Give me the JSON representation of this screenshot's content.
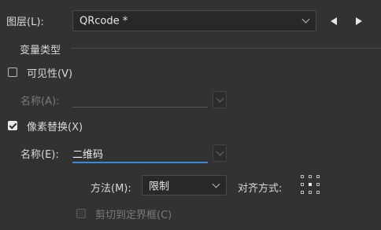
{
  "layer": {
    "label": "图层(L):",
    "value": "QRcode *"
  },
  "variable_types": {
    "title": "变量类型"
  },
  "visibility": {
    "label": "可见性(V)",
    "checked": false,
    "name_label": "名称(A):",
    "name_value": ""
  },
  "pixel_replace": {
    "label": "像素替换(X)",
    "checked": true,
    "name_label": "名称(E):",
    "name_value": "二维码",
    "method_label": "方法(M):",
    "method_value": "限制",
    "align_label": "对齐方式:",
    "clip_label": "剪切到定界框(C)",
    "clip_checked": false
  },
  "colors": {
    "background": "#323232",
    "accent": "#3b8ad8"
  }
}
